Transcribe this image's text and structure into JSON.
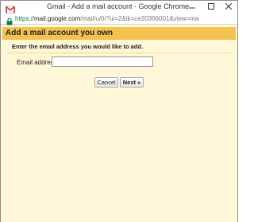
{
  "window": {
    "title": "Gmail - Add a mail account - Google Chrome",
    "controls": [
      "minimize-icon",
      "maximize-icon",
      "close-icon"
    ]
  },
  "address_bar": {
    "url_scheme": "https://",
    "url_host": "mail.google.com",
    "url_path": "/mail/u/0/?ui=2&ik=ce20366001&view=ma"
  },
  "dialog": {
    "title": "Add a mail account you own",
    "instruction": "Enter the email address you would like to add.",
    "email_label": "Email address:",
    "email_value": "",
    "cancel_label": "Cancel",
    "next_label": "Next »"
  },
  "colors": {
    "header": "#f3c24f",
    "background": "#fff7d7",
    "secure_url": "#0b8043"
  }
}
